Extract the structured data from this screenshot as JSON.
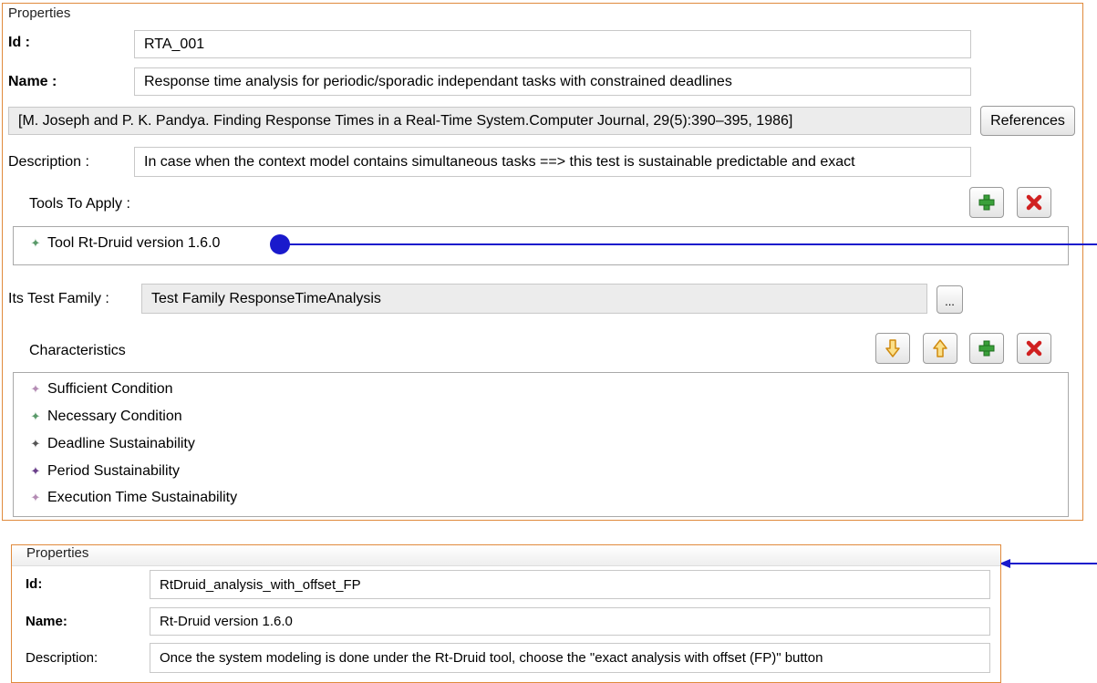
{
  "top": {
    "legend": "Properties",
    "id_label": "Id :",
    "id_value": "RTA_001",
    "name_label": "Name :",
    "name_value": "Response time analysis  for periodic/sporadic independant tasks with constrained deadlines",
    "reference_value": "[M. Joseph and P. K. Pandya. Finding Response Times in a Real-Time System.Computer Journal, 29(5):390–395, 1986]",
    "references_button": "References",
    "description_label": "Description :",
    "description_value": "In case when the context model contains simultaneous tasks ==> this test is sustainable predictable and exact",
    "tools_label": "Tools To Apply :",
    "tools": [
      {
        "label": "Tool Rt-Druid version 1.6.0",
        "icon": "green-diamond-icon",
        "color": "#5a9a6a"
      }
    ],
    "family_label": "Its Test Family :",
    "family_value": "Test Family ResponseTimeAnalysis",
    "browse_button": "...",
    "characteristics_label": "Characteristics",
    "characteristics": [
      {
        "label": "Sufficient Condition",
        "icon": "pink-diamond-icon",
        "color": "#b48cb4"
      },
      {
        "label": "Necessary Condition",
        "icon": "green-diamond-icon",
        "color": "#5a9a6a"
      },
      {
        "label": "Deadline Sustainability",
        "icon": "dark-diamond-icon",
        "color": "#555555"
      },
      {
        "label": "Period Sustainability",
        "icon": "purple-diamond-icon",
        "color": "#6a3f8a"
      },
      {
        "label": "Execution Time Sustainability",
        "icon": "pink-diamond-icon",
        "color": "#b48cb4"
      }
    ]
  },
  "bottom": {
    "legend": "Properties",
    "id_label": "Id:",
    "id_value": "RtDruid_analysis_with_offset_FP",
    "name_label": "Name:",
    "name_value": "Rt-Druid version 1.6.0",
    "description_label": "Description:",
    "description_value": "Once the system modeling is done under the Rt-Druid tool, choose the \"exact analysis with offset (FP)\" button"
  },
  "colors": {
    "panel_border": "#e08a3c",
    "connector": "#1a1acc",
    "add": "#3aa03a",
    "remove": "#d02020",
    "arrow": "#e0a020"
  }
}
